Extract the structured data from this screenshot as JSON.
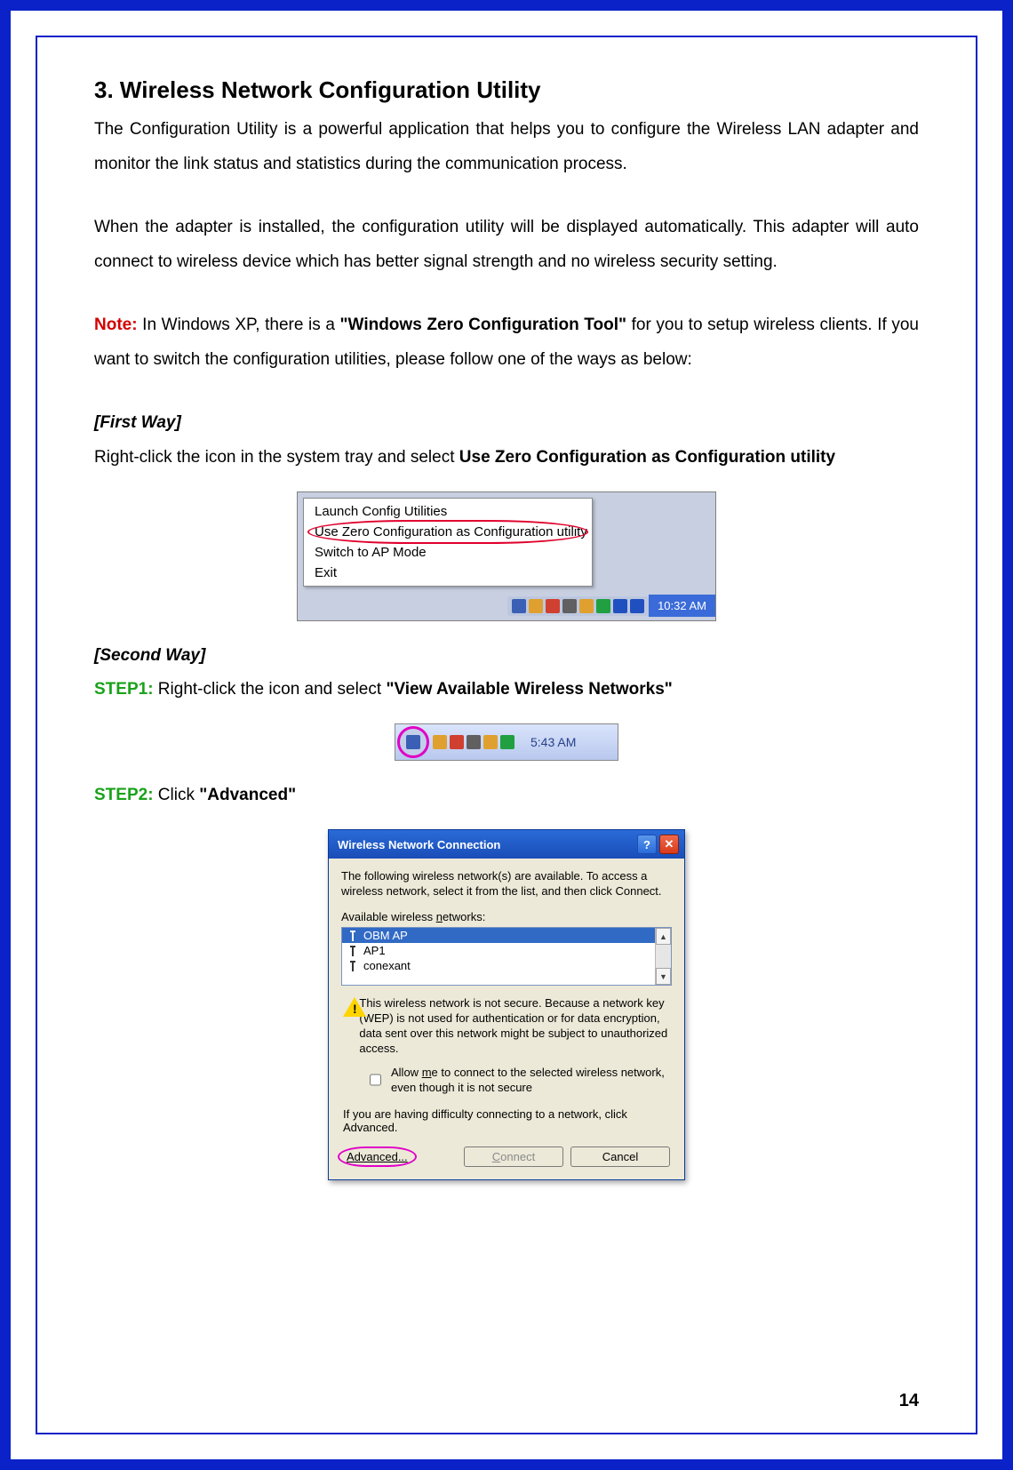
{
  "heading": "3.  Wireless Network Configuration Utility",
  "p1": "The Configuration Utility is a powerful application that helps you to configure the Wireless LAN adapter and monitor the link status and statistics during the communication process.",
  "p2": "When the adapter is installed, the configuration utility will be displayed automatically. This adapter will auto connect to wireless device which has better signal strength and no wireless security setting.",
  "note_label": "Note:",
  "note_pre": " In Windows XP, there is a ",
  "wzc": "\"Windows Zero Configuration Tool\"",
  "note_post": " for you to setup wireless clients. If you want to switch the configuration utilities, please follow one of the ways as below:",
  "first_way": "[First Way]",
  "first_instr_pre": "Right-click the icon in the system tray and select ",
  "first_instr_bold": "Use Zero Configuration as Configuration utility",
  "ctx": {
    "items": [
      "Launch Config Utilities",
      "Use Zero Configuration as Configuration utility",
      "Switch to AP Mode",
      "Exit"
    ],
    "time": "10:32 AM"
  },
  "second_way": "[Second Way]",
  "step1_label": "STEP1:",
  "step1_pre": " Right-click the icon and select ",
  "step1_bold": "\"View Available Wireless Networks\"",
  "tray2_time": "5:43 AM",
  "step2_label": "STEP2:",
  "step2_pre": " Click ",
  "step2_bold": "\"Advanced\"",
  "dlg": {
    "title": "Wireless Network Connection",
    "intro": "The following wireless network(s) are available. To access a wireless network, select it from the list, and then click Connect.",
    "avail_pre": "Available wireless ",
    "avail_ul": "n",
    "avail_post": "etworks:",
    "networks": [
      "OBM AP",
      "AP1",
      "conexant"
    ],
    "warn": "This wireless network is not secure. Because a network key (WEP) is not used for authentication or for data encryption, data sent over this network might be subject to unauthorized access.",
    "allow_pre": "Allow ",
    "allow_ul": "m",
    "allow_post": "e to connect to the selected wireless network, even though it is not secure",
    "advhelp": "If you are having difficulty connecting to a network, click Advanced.",
    "adv_ul": "A",
    "adv_post": "dvanced...",
    "connect_ul": "C",
    "connect_post": "onnect",
    "cancel": "Cancel"
  },
  "page_num": "14"
}
